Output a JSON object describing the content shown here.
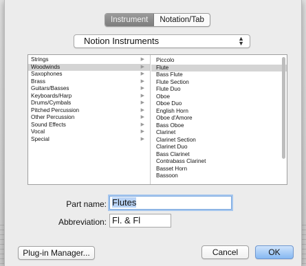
{
  "tabs": [
    {
      "label": "Instrument",
      "selected": true
    },
    {
      "label": "Notation/Tab",
      "selected": false
    }
  ],
  "library_select": {
    "value": "Notion Instruments"
  },
  "families": [
    {
      "label": "Strings"
    },
    {
      "label": "Woodwinds",
      "selected": true
    },
    {
      "label": "Saxophones"
    },
    {
      "label": "Brass"
    },
    {
      "label": "Guitars/Basses"
    },
    {
      "label": "Keyboards/Harp"
    },
    {
      "label": "Drums/Cymbals"
    },
    {
      "label": "Pitched Percussion"
    },
    {
      "label": "Other Percussion"
    },
    {
      "label": "Sound Effects"
    },
    {
      "label": "Vocal"
    },
    {
      "label": "Special"
    }
  ],
  "instruments": [
    {
      "label": "Piccolo"
    },
    {
      "label": "Flute",
      "selected": true
    },
    {
      "label": "Bass Flute"
    },
    {
      "label": "Flute Section"
    },
    {
      "label": "Flute Duo"
    },
    {
      "label": "Oboe"
    },
    {
      "label": "Oboe Duo"
    },
    {
      "label": "English Horn"
    },
    {
      "label": "Oboe d'Amore"
    },
    {
      "label": "Bass Oboe"
    },
    {
      "label": "Clarinet"
    },
    {
      "label": "Clarinet Section"
    },
    {
      "label": "Clarinet Duo"
    },
    {
      "label": "Bass Clarinet"
    },
    {
      "label": "Contrabass Clarinet"
    },
    {
      "label": "Basset Horn"
    },
    {
      "label": "Bassoon"
    }
  ],
  "part_name": {
    "label": "Part name:",
    "value": "Flutes"
  },
  "abbreviation": {
    "label": "Abbreviation:",
    "value": "Fl. & Fl"
  },
  "buttons": {
    "plugin_manager": "Plug-in Manager...",
    "cancel": "Cancel",
    "ok": "OK"
  },
  "colors": {
    "selection": "#d4d4d4",
    "default_button": "#86b8f2",
    "focus_ring": "#a5c6ee"
  }
}
